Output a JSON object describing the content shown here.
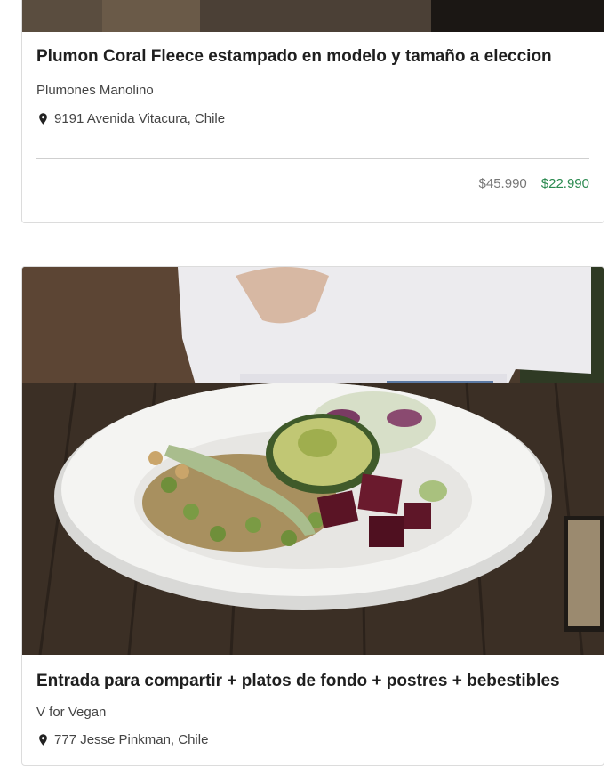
{
  "deals": [
    {
      "title": "Plumon Coral Fleece estampado en modelo y tamaño a eleccion",
      "merchant": "Plumones Manolino",
      "location": "9191 Avenida Vitacura, Chile",
      "price_original": "$45.990",
      "price_discounted": "$22.990",
      "image": "bedding-photo"
    },
    {
      "title": "Entrada para compartir + platos de fondo + postres + bebestibles",
      "merchant": "V for Vegan",
      "location": "777 Jesse Pinkman, Chile",
      "image": "vegan-bowl-photo"
    }
  ],
  "colors": {
    "discount_price": "#2a8a4f",
    "original_price": "#777777",
    "border": "#dcdcdc"
  }
}
